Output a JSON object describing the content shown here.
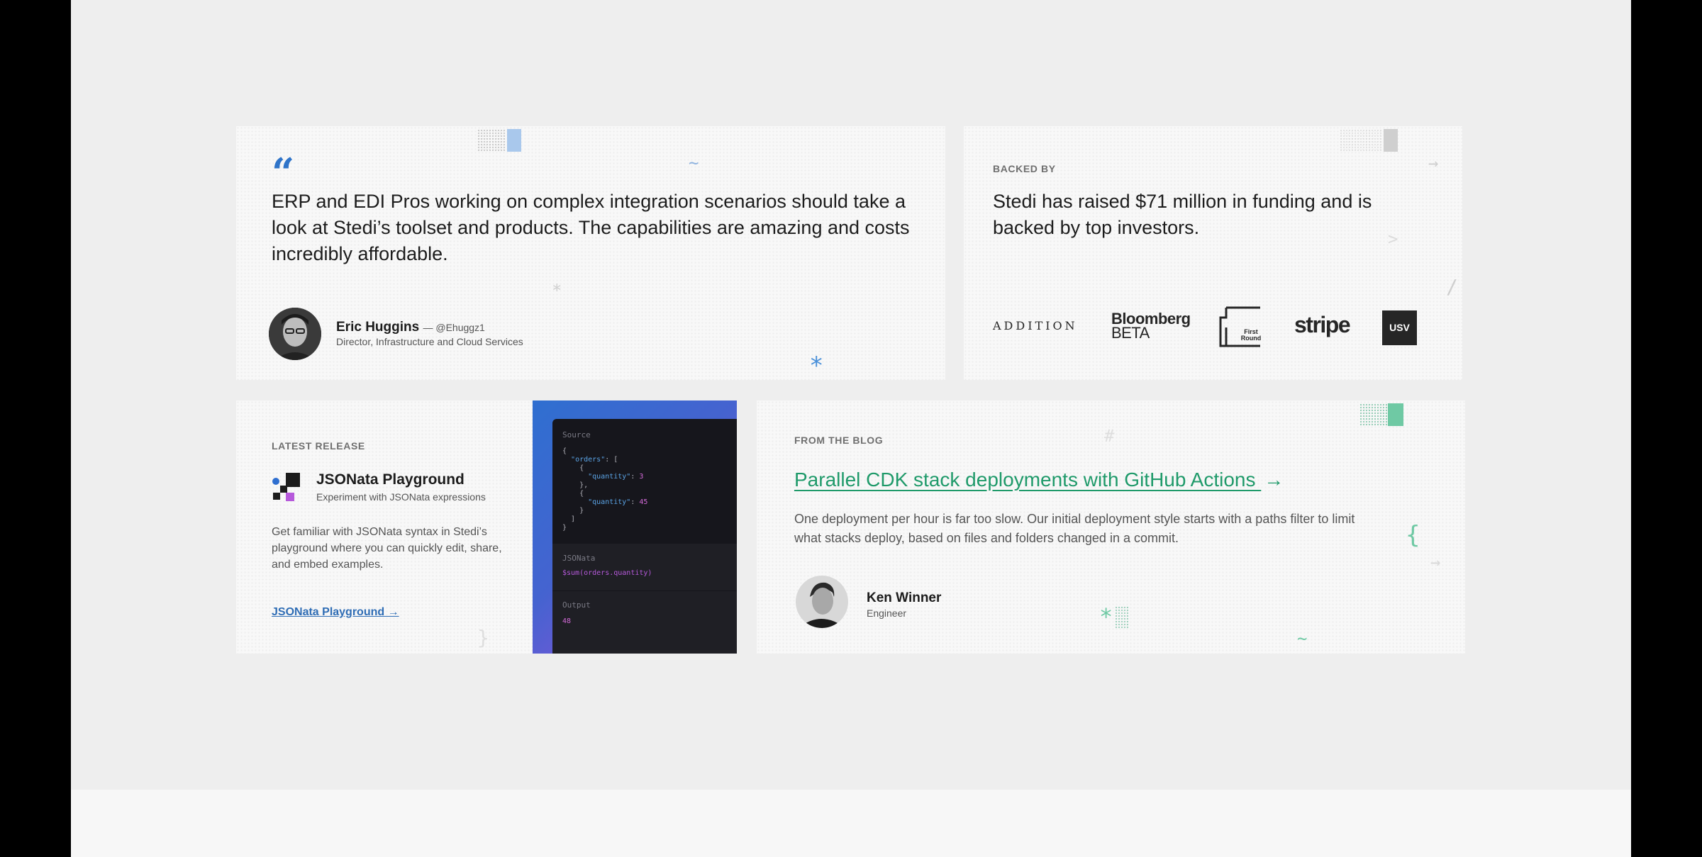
{
  "testimonial": {
    "quote_mark": "“",
    "quote": "ERP and EDI Pros working on complex integration scenarios should take a look at Stedi’s toolset and products. The capabilities are amazing and costs incredibly affordable.",
    "name": "Eric Huggins",
    "handle": "— @Ehuggz1",
    "role": "Director, Infrastructure and Cloud Services"
  },
  "investors": {
    "eyebrow": "BACKED BY",
    "text": "Stedi has raised $71 million in funding and is backed by top investors.",
    "logos": {
      "addition": "ADDITION",
      "bloomberg_line1": "Bloomberg",
      "bloomberg_line2": "BETA",
      "firstround": "First Round",
      "stripe": "stripe",
      "usv": "USV"
    }
  },
  "release": {
    "eyebrow": "LATEST RELEASE",
    "title": "JSONata Playground",
    "subtitle": "Experiment with JSONata expressions",
    "description": "Get familiar with JSONata syntax in Stedi’s playground where you can quickly edit, share, and embed examples.",
    "link": "JSONata Playground →",
    "code": {
      "source_label": "Source",
      "jsonata_label": "JSONata",
      "expression": "$sum(orders.quantity)",
      "output_label": "Output",
      "output_value": "48"
    }
  },
  "blog": {
    "eyebrow": "FROM THE BLOG",
    "title": "Parallel CDK stack deployments with GitHub Actions",
    "title_arrow": "→",
    "description": "One deployment per hour is far too slow. Our initial deployment style starts with a paths filter to limit what stacks deploy, based on files and folders changed in a commit.",
    "author_name": "Ken Winner",
    "author_role": "Engineer"
  },
  "colors": {
    "quote_blue": "#2f74c9",
    "blog_green": "#1f9a6a",
    "link_blue": "#2f6db5"
  }
}
